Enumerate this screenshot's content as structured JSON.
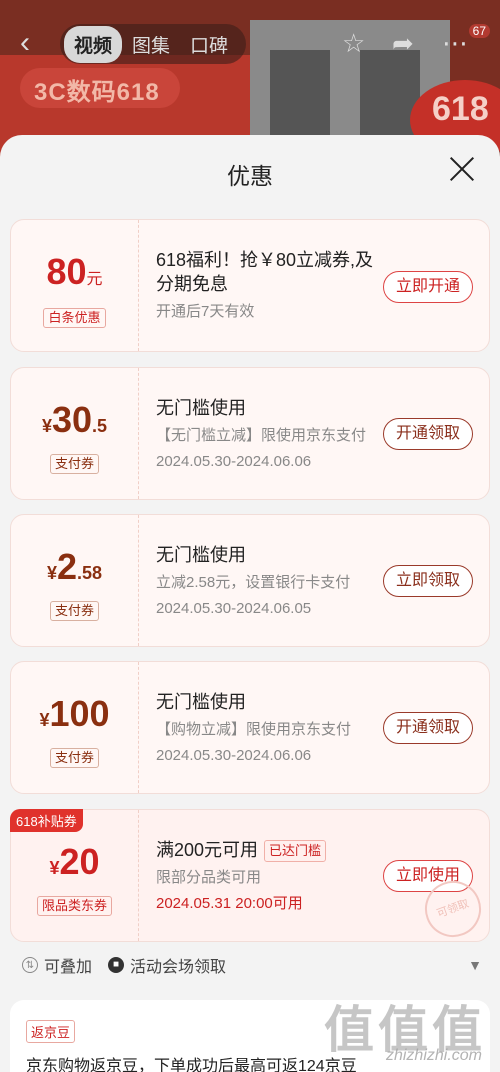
{
  "header": {
    "banner_text": "3C数码618",
    "banner_badge": "618",
    "tabs": [
      "视频",
      "图集",
      "口碑"
    ],
    "message_count": "67"
  },
  "sheet": {
    "title": "优惠"
  },
  "coupons": [
    {
      "amount": "80",
      "unit": "元",
      "tag": "白条优惠",
      "line1": "618福利！抢￥80立减券,及分期免息",
      "line3": "开通后7天有效",
      "button": "立即开通"
    },
    {
      "yen": "¥",
      "amount": "30",
      "decimal": ".5",
      "tag": "支付券",
      "line1": "无门槛使用",
      "line2": "【无门槛立减】限使用京东支付",
      "line3": "2024.05.30-2024.06.06",
      "button": "开通领取"
    },
    {
      "yen": "¥",
      "amount": "2",
      "decimal": ".58",
      "tag": "支付券",
      "line1": "无门槛使用",
      "line2": "立减2.58元，设置银行卡支付",
      "line3": "2024.05.30-2024.06.05",
      "button": "立即领取"
    },
    {
      "yen": "¥",
      "amount": "100",
      "tag": "支付券",
      "line1": "无门槛使用",
      "line2": "【购物立减】限使用京东支付",
      "line3": "2024.05.30-2024.06.06",
      "button": "开通领取"
    },
    {
      "corner_tag": "618补贴券",
      "yen": "¥",
      "amount": "20",
      "tag": "限品类东券",
      "line1": "满200元可用",
      "reached": "已达门槛",
      "line2": "限部分品类可用",
      "line3": "2024.05.31 20:00可用",
      "button": "立即使用",
      "stamp": "可领取"
    }
  ],
  "footer": {
    "stackable": "可叠加",
    "venue": "活动会场领取"
  },
  "jd_beans": {
    "tag": "返京豆",
    "text": "京东购物返京豆，下单成功后最高可返124京豆"
  },
  "watermark": {
    "logo": "值值值",
    "url": "zhizhizhi.com"
  },
  "colors": {
    "accent": "#c22222",
    "brand_dark": "#8a2f1c"
  }
}
